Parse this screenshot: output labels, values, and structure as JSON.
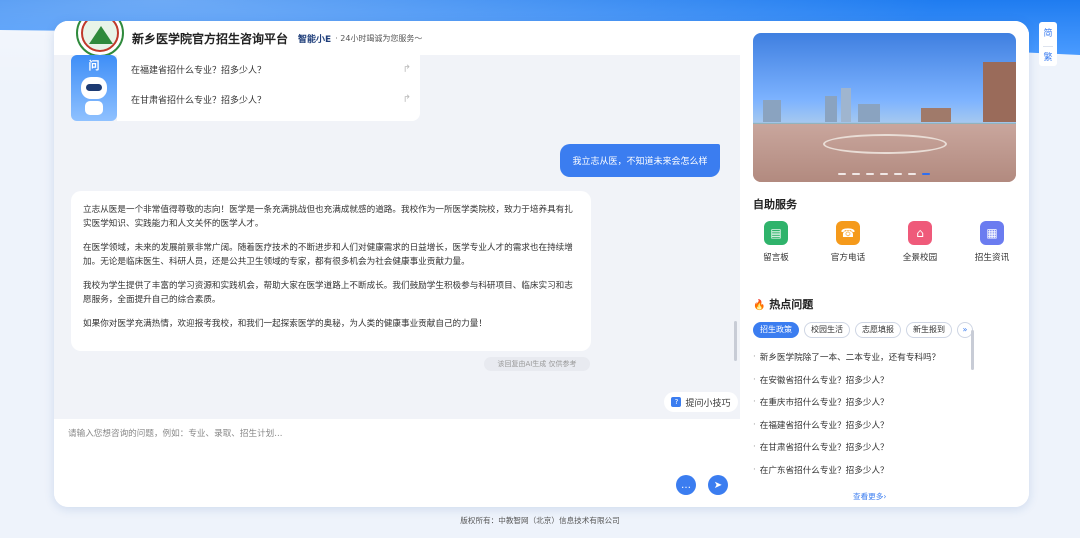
{
  "header": {
    "site_title": "新乡医学院官方招生咨询平台",
    "brand": "智能小E",
    "tagline": "· 24小时竭诚为您服务～"
  },
  "bot": {
    "avatar_label": "问"
  },
  "suggested_questions": [
    {
      "text": "在福建省招什么专业？招多少人？"
    },
    {
      "text": "在甘肃省招什么专业？招多少人？"
    }
  ],
  "chat": {
    "user_message": "我立志从医，不知道未来会怎么样",
    "answer_paragraphs": [
      "立志从医是一个非常值得尊敬的志向！医学是一条充满挑战但也充满成就感的道路。我校作为一所医学类院校，致力于培养具有扎实医学知识、实践能力和人文关怀的医学人才。",
      "在医学领域，未来的发展前景非常广阔。随着医疗技术的不断进步和人们对健康需求的日益增长，医学专业人才的需求也在持续增加。无论是临床医生、科研人员，还是公共卫生领域的专家，都有很多机会为社会健康事业贡献力量。",
      "我校为学生提供了丰富的学习资源和实践机会，帮助大家在医学道路上不断成长。我们鼓励学生积极参与科研项目、临床实习和志愿服务，全面提升自己的综合素质。",
      "如果你对医学充满热情，欢迎报考我校，和我们一起探索医学的奥秘，为人类的健康事业贡献自己的力量！"
    ],
    "ai_note": "该回复由AI生成 仅供参考",
    "tips_label": "提问小技巧"
  },
  "input": {
    "placeholder": "请输入您想咨询的问题，例如：专业、录取、招生计划..."
  },
  "self_service": {
    "title": "自助服务",
    "items": [
      {
        "label": "留言板",
        "icon": "message-board-icon",
        "color": "#2fb36b"
      },
      {
        "label": "官方电话",
        "icon": "phone-icon",
        "color": "#f59a1b"
      },
      {
        "label": "全景校园",
        "icon": "campus-icon",
        "color": "#ef5a7a"
      },
      {
        "label": "招生资讯",
        "icon": "news-icon",
        "color": "#6b7cf0"
      }
    ]
  },
  "hot": {
    "title": "热点问题",
    "tabs": [
      "招生政策",
      "校园生活",
      "志愿填报",
      "新生报到"
    ],
    "active_tab": 0,
    "questions": [
      "新乡医学院除了一本、二本专业，还有专科吗？",
      "在安徽省招什么专业？招多少人？",
      "在重庆市招什么专业？招多少人？",
      "在福建省招什么专业？招多少人？",
      "在甘肃省招什么专业？招多少人？",
      "在广东省招什么专业？招多少人？"
    ],
    "more_label": "查看更多›"
  },
  "banner": {
    "slide_count": 7,
    "active_slide": 6
  },
  "lang": {
    "simplified": "简",
    "traditional": "繁"
  },
  "footer": "版权所有：中教智网（北京）信息技术有限公司",
  "colors": {
    "primary": "#3b7df0",
    "header_blue": "#1f7cf0"
  }
}
